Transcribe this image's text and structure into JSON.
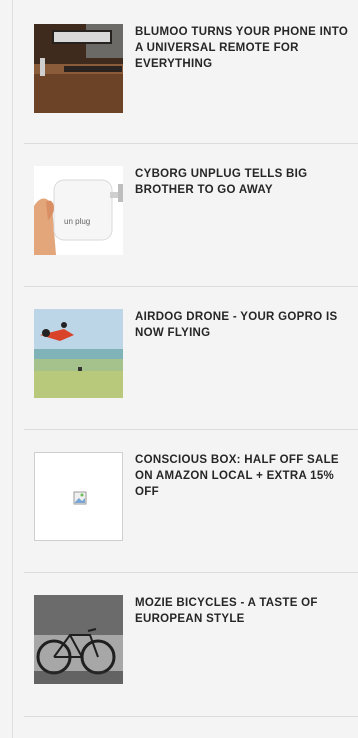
{
  "articles": [
    {
      "title": "BLUMOO TURNS YOUR PHONE INTO A UNIVERSAL REMOTE FOR EVERYTHING",
      "thumb": "tv-console-photo"
    },
    {
      "title": "CYBORG UNPLUG TELLS BIG BROTHER TO GO AWAY",
      "thumb": "unplug-device-photo",
      "device_text": "un plug"
    },
    {
      "title": "AIRDOG DRONE - YOUR GOPRO IS NOW FLYING",
      "thumb": "drone-beach-photo"
    },
    {
      "title": "CONSCIOUS BOX: HALF OFF SALE ON AMAZON LOCAL + EXTRA 15% OFF",
      "thumb": "broken-image-icon"
    },
    {
      "title": "MOZIE BICYCLES - A TASTE OF EUROPEAN STYLE",
      "thumb": "bicycle-photo"
    }
  ]
}
